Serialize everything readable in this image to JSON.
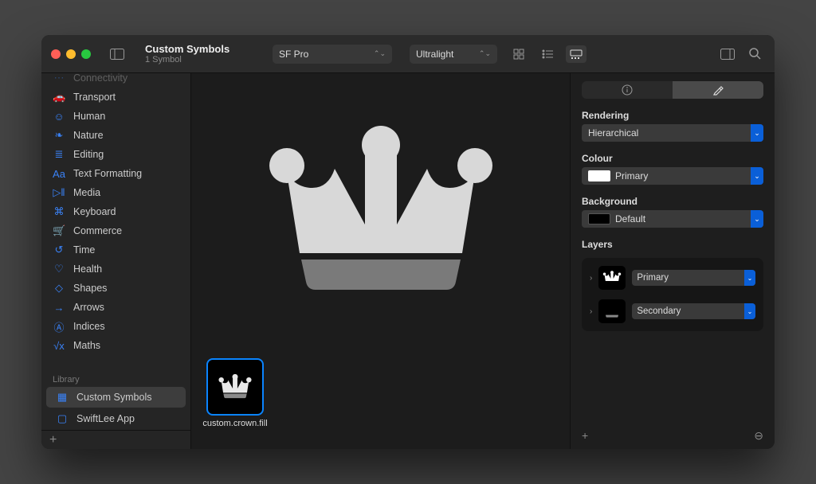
{
  "header": {
    "title": "Custom Symbols",
    "subtitle": "1 Symbol",
    "font": "SF Pro",
    "weight": "Ultralight"
  },
  "sidebar": {
    "categories": [
      {
        "icon": "⋯",
        "label": "Connectivity"
      },
      {
        "icon": "🚗",
        "label": "Transport"
      },
      {
        "icon": "☺",
        "label": "Human"
      },
      {
        "icon": "❧",
        "label": "Nature"
      },
      {
        "icon": "≣",
        "label": "Editing"
      },
      {
        "icon": "Aa",
        "label": "Text Formatting"
      },
      {
        "icon": "▷‖",
        "label": "Media"
      },
      {
        "icon": "⌘",
        "label": "Keyboard"
      },
      {
        "icon": "🛒",
        "label": "Commerce"
      },
      {
        "icon": "↺",
        "label": "Time"
      },
      {
        "icon": "♡",
        "label": "Health"
      },
      {
        "icon": "◇",
        "label": "Shapes"
      },
      {
        "icon": "→",
        "label": "Arrows"
      },
      {
        "icon": "Ⓐ",
        "label": "Indices"
      },
      {
        "icon": "√x",
        "label": "Maths"
      }
    ],
    "library_header": "Library",
    "library": [
      {
        "icon": "▦",
        "label": "Custom Symbols",
        "selected": true
      },
      {
        "icon": "▢",
        "label": "SwiftLee App",
        "selected": false
      }
    ]
  },
  "gallery": {
    "items": [
      {
        "label": "custom.crown.fill"
      }
    ]
  },
  "inspector": {
    "rendering": {
      "title": "Rendering",
      "value": "Hierarchical"
    },
    "colour": {
      "title": "Colour",
      "value": "Primary"
    },
    "background": {
      "title": "Background",
      "value": "Default"
    },
    "layers": {
      "title": "Layers",
      "rows": [
        {
          "value": "Primary"
        },
        {
          "value": "Secondary"
        }
      ]
    }
  }
}
